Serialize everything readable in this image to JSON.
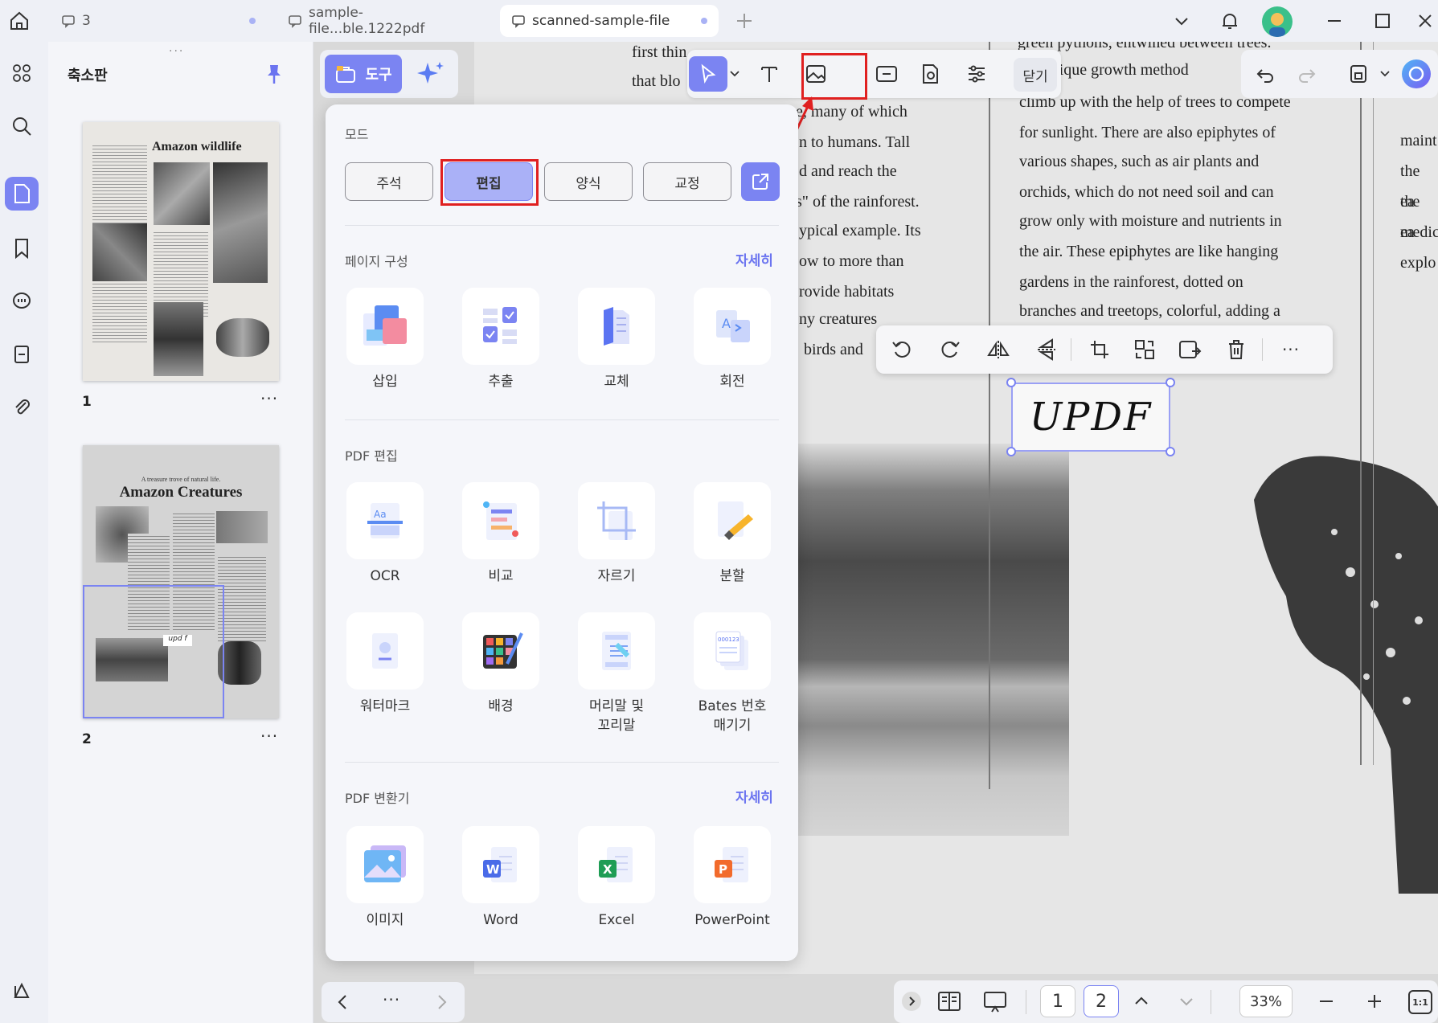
{
  "tabs": [
    {
      "label": "3"
    },
    {
      "label": "sample-file...ble.1222pdf"
    },
    {
      "label": "scanned-sample-file"
    }
  ],
  "thumbnail_panel": {
    "title": "축소판",
    "pages": [
      {
        "number": "1",
        "heading": "Amazon wildlife"
      },
      {
        "number": "2",
        "subheading": "A treasure trove of natural life.",
        "heading": "Amazon Creatures"
      }
    ]
  },
  "tool_button": {
    "label": "도구"
  },
  "panel": {
    "mode_title": "모드",
    "modes": [
      {
        "label": "주석"
      },
      {
        "label": "편집"
      },
      {
        "label": "양식"
      },
      {
        "label": "교정"
      }
    ],
    "page_section": {
      "title": "페이지 구성",
      "more": "자세히",
      "items": [
        {
          "label": "삽입",
          "icon": "insert-page-icon"
        },
        {
          "label": "추출",
          "icon": "extract-page-icon"
        },
        {
          "label": "교체",
          "icon": "replace-page-icon"
        },
        {
          "label": "회전",
          "icon": "rotate-page-icon"
        }
      ]
    },
    "edit_section": {
      "title": "PDF 편집",
      "items": [
        {
          "label": "OCR",
          "icon": "ocr-icon"
        },
        {
          "label": "비교",
          "icon": "compare-icon"
        },
        {
          "label": "자르기",
          "icon": "crop-icon"
        },
        {
          "label": "분할",
          "icon": "split-icon"
        },
        {
          "label": "워터마크",
          "icon": "watermark-icon"
        },
        {
          "label": "배경",
          "icon": "background-icon"
        },
        {
          "label_line1": "머리말 및",
          "label_line2": "꼬리말",
          "icon": "header-footer-icon"
        },
        {
          "label_line1": "Bates 번호",
          "label_line2": "매기기",
          "icon": "bates-number-icon"
        }
      ]
    },
    "convert_section": {
      "title": "PDF 변환기",
      "more": "자세히",
      "items": [
        {
          "label": "이미지",
          "icon": "image-file-icon"
        },
        {
          "label": "Word",
          "icon": "word-file-icon"
        },
        {
          "label": "Excel",
          "icon": "excel-file-icon"
        },
        {
          "label": "PowerPoint",
          "icon": "powerpoint-file-icon"
        }
      ]
    }
  },
  "doc_toolbar": {
    "close_label": "닫기"
  },
  "document_text": {
    "left_lines": [
      "first thin",
      "that blo",
      "e, many of which",
      "n to humans. Tall",
      "d and reach the",
      "s\" of the rainforest.",
      "ypical example. Its",
      "ow to more than",
      "rovide habitats",
      "ny creatures",
      "birds and"
    ],
    "right_lines": [
      "green pythons, entwined between trees.",
      "r unique growth method",
      "climb up with the help of trees to compete",
      "for sunlight. There are also epiphytes of",
      "various shapes, such as air plants and",
      "orchids, which do not need soil and can",
      "grow only with moisture and nutrients in",
      "the air. These epiphytes are like hanging",
      "gardens in the rainforest, dotted on",
      "branches and treetops, colorful, adding a"
    ],
    "edge_lines": [
      "maint",
      "the ea",
      "the ea",
      "medic",
      "explo"
    ],
    "signature": "UPDF"
  },
  "status": {
    "pages": [
      "1",
      "2"
    ],
    "zoom": "33%",
    "fit_label": "1:1"
  },
  "colors": {
    "accent": "#7b84f2",
    "highlight": "#e02020"
  }
}
